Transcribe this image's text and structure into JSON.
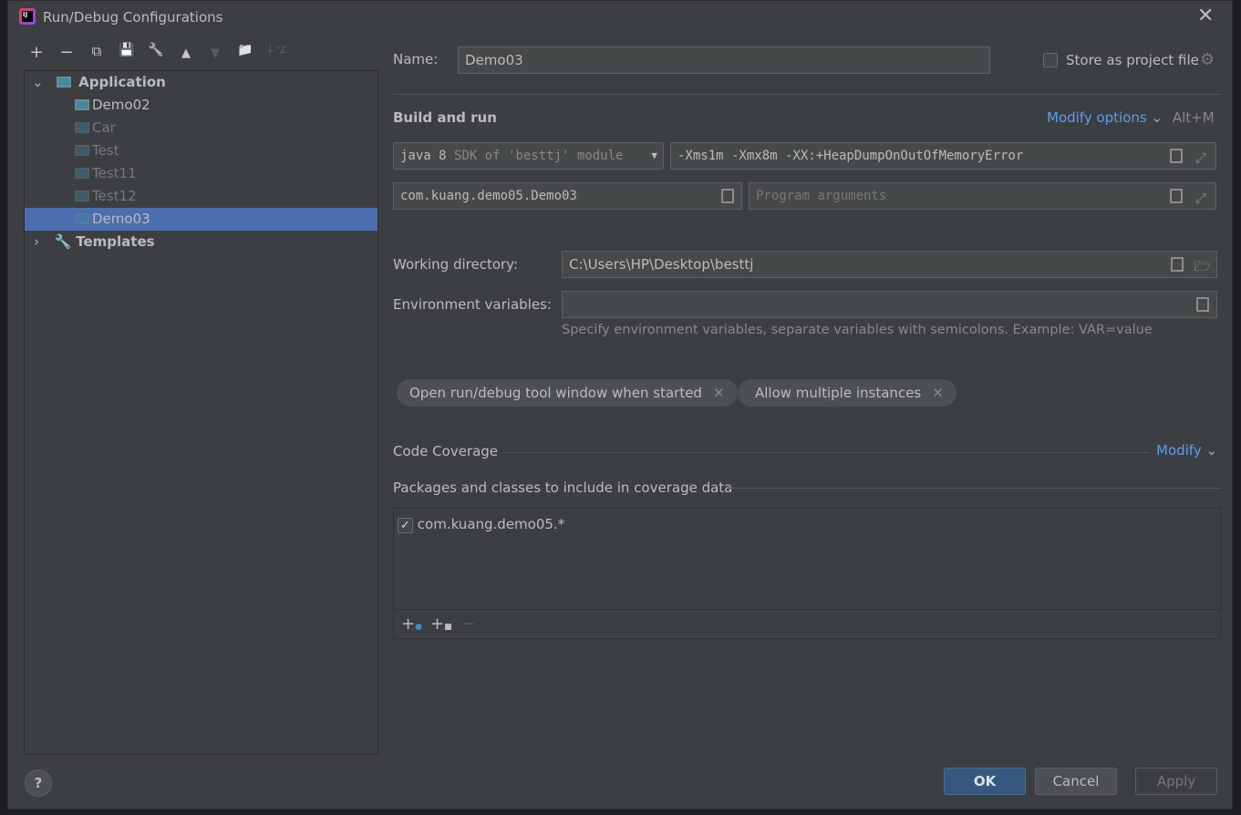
{
  "window": {
    "title": "Run/Debug Configurations",
    "logo_text": "IJ"
  },
  "toolbar": {
    "add": "+",
    "remove": "−",
    "copy": "⧉",
    "save": "💾",
    "edit": "🔧",
    "up": "▲",
    "down": "▼",
    "folder": "📁",
    "sort": "↓ᵃz"
  },
  "tree": {
    "application": "Application",
    "items": [
      {
        "label": "Demo02",
        "dim": false
      },
      {
        "label": "Car",
        "dim": true
      },
      {
        "label": "Test",
        "dim": true
      },
      {
        "label": "Test11",
        "dim": true
      },
      {
        "label": "Test12",
        "dim": true
      },
      {
        "label": "Demo03",
        "dim": false,
        "selected": true
      }
    ],
    "templates": "Templates"
  },
  "form": {
    "name_label": "Name:",
    "name_value": "Demo03",
    "store_label": "Store as project file",
    "store_checked": false,
    "build_run": "Build and run",
    "modify_options": "Modify options",
    "modify_shortcut": "Alt+M",
    "jre_main": "java 8",
    "jre_sub": "SDK of 'besttj' module",
    "vm_options": "-Xms1m -Xmx8m -XX:+HeapDumpOnOutOfMemoryError",
    "main_class": "com.kuang.demo05.Demo03",
    "program_args_placeholder": "Program arguments",
    "workdir_label": "Working directory:",
    "workdir_value": "C:\\Users\\HP\\Desktop\\besttj",
    "env_label": "Environment variables:",
    "env_value": "",
    "env_hint": "Specify environment variables, separate variables with semicolons. Example: VAR=value",
    "chips": [
      "Open run/debug tool window when started",
      "Allow multiple instances"
    ],
    "coverage_title": "Code Coverage",
    "coverage_modify": "Modify",
    "packages_title": "Packages and classes to include in coverage data",
    "packages": [
      {
        "label": "com.kuang.demo05.*",
        "checked": true
      }
    ]
  },
  "buttons": {
    "help": "?",
    "ok": "OK",
    "cancel": "Cancel",
    "apply": "Apply"
  },
  "colors": {
    "accent": "#589df6",
    "selection": "#4b6eaf",
    "ok": "#365880"
  }
}
